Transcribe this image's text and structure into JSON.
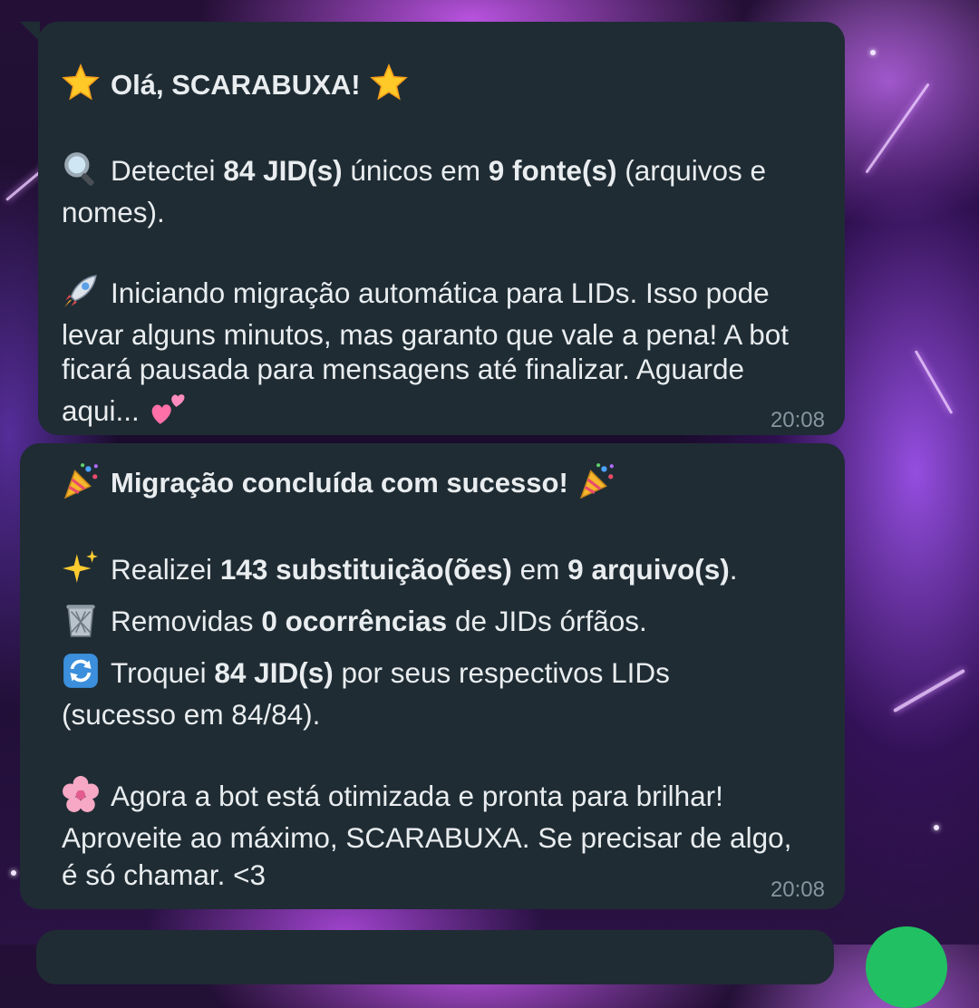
{
  "messages": [
    {
      "id": "msg1",
      "title": {
        "emoji": "star-emoji",
        "text": "Olá, SCARABUXA!"
      },
      "detect": {
        "emoji": "magnifier-emoji",
        "pre": "Detectei ",
        "jid_count": "84 JID(s)",
        "mid": " únicos em ",
        "sources": "9 fonte(s)",
        "post": " (arquivos e",
        "line2": "nomes)."
      },
      "start": {
        "emoji": "rocket-emoji",
        "line1": "Iniciando migração automática para LIDs. Isso pode",
        "line2": "levar alguns minutos, mas garanto que vale a pena! A bot",
        "line3": "ficará pausada para mensagens até finalizar. Aguarde",
        "line4": "aqui...",
        "trail_emoji": "two-hearts-emoji"
      },
      "time": "20:08"
    },
    {
      "id": "msg2",
      "title": {
        "emoji": "party-popper-emoji",
        "text": "Migração concluída com sucesso!"
      },
      "replace": {
        "emoji": "sparkles-emoji",
        "pre": "Realizei ",
        "count": "143 substituição(ões)",
        "mid": " em ",
        "files": "9 arquivo(s)",
        "post": "."
      },
      "removed": {
        "emoji": "wastebasket-emoji",
        "pre": "Removidas ",
        "count": "0 ocorrências",
        "post": " de JIDs órfãos."
      },
      "swapped": {
        "emoji": "arrows-cycle-emoji",
        "pre": "Troquei ",
        "count": "84 JID(s)",
        "post": " por seus respectivos LIDs",
        "line2": "(sucesso em 84/84)."
      },
      "final": {
        "emoji": "cherry-blossom-emoji",
        "line1": "Agora a bot está otimizada e pronta para brilhar!",
        "line2": "Aproveite ao máximo, SCARABUXA. Se precisar de algo,",
        "line3": "é só chamar. <3"
      },
      "time": "20:08"
    }
  ],
  "colors": {
    "bubble_bg": "#1f2c34",
    "text": "#e9edef",
    "timestamp": "#8696a0",
    "fab_green": "#21c063"
  }
}
